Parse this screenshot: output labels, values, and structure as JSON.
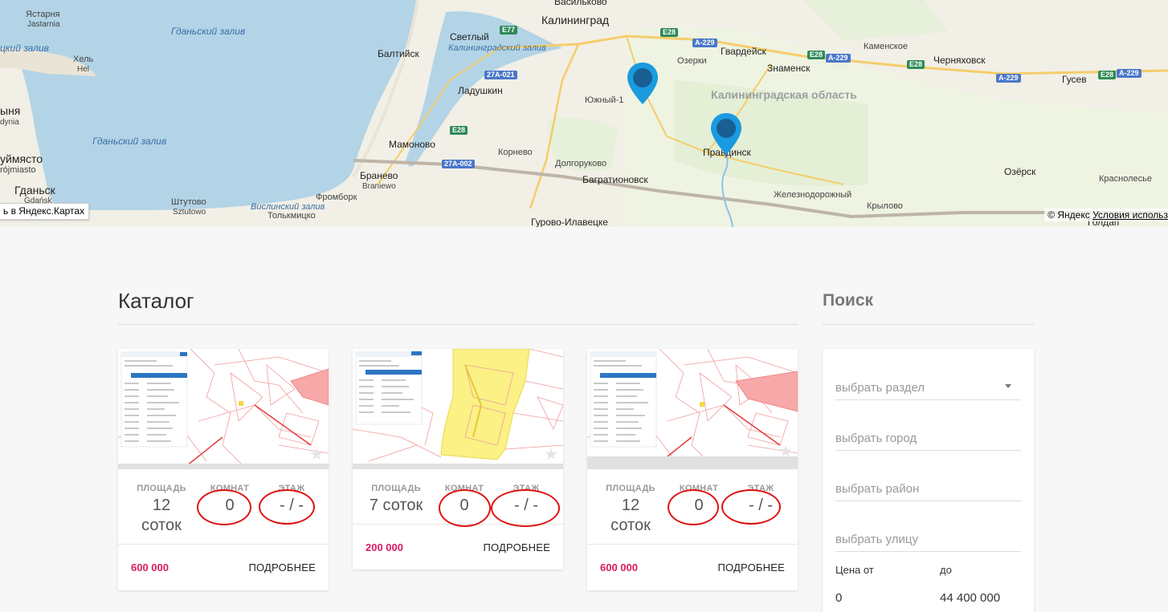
{
  "map": {
    "open_link": "ь в Яндекс.Картах",
    "copyright": "© Яндекс",
    "terms_link": "Условия использ",
    "region_label": "Калининградская область",
    "places": {
      "kaliningrad": "Калининград",
      "vasilkovo": "Васильково",
      "svetly": "Светлый",
      "baltiysk": "Балтийск",
      "ladushkin": "Ладушкин",
      "mamonovo": "Мамоново",
      "kornevo": "Корнево",
      "dolgorukovo": "Долгоруково",
      "bagrationovsk": "Багратионовск",
      "yuzhny": "Южный-1",
      "ozerki": "Озерки",
      "gvardeysk": "Гвардейск",
      "znamensk": "Знаменск",
      "kamenskoe": "Каменское",
      "chernyakhovsk": "Черняховск",
      "gusev": "Гусев",
      "pravdinsk": "Правдинск",
      "ozyorsk": "Озёрск",
      "zheleznodorozhny": "Железнодорожный",
      "krylovo": "Крылово",
      "krasnolesye": "Краснолесье",
      "goldap": "Голдап",
      "gurovo": "Гурово-Илавецке",
      "braniewo_ru": "Бранево",
      "braniewo_pl": "Braniewo",
      "frombork": "Фромборк",
      "shtutovo_ru": "Штутово",
      "shtutovo_pl": "Sztutowo",
      "tolkmicko": "Толькмицко",
      "yastarnya_ru": "Ястарня",
      "yastarnya_pl": "Jastarnia",
      "hel_ru": "Хель",
      "hel_pl": "Hel",
      "gdynia_ru": "ыня",
      "gdynia_pl": "dynia",
      "sopot_ru": "уймясто",
      "sopot_pl": "rójmiasto",
      "gdansk_ru": "Гданьск",
      "gdansk_pl": "Gdańsk"
    },
    "water": {
      "gulf1": "Гданьский залив",
      "gulf2": "Гданьский залив",
      "gulf3": "цкий залив",
      "kal_gulf": "Калининградский залив",
      "vist_gulf": "Вислинский залив"
    },
    "roads": {
      "e77": "E77",
      "e28a": "E28",
      "e28b": "E28",
      "e28c": "E28",
      "e28d": "E28",
      "e28e": "E28",
      "a229a": "A-229",
      "a229b": "A-229",
      "a229c": "A-229",
      "a229d": "A-229",
      "r021": "27A-021",
      "r002": "27A-002"
    }
  },
  "catalog": {
    "title": "Каталог",
    "cards": [
      {
        "specs": [
          {
            "title": "ПЛОЩАДЬ",
            "value": "12 соток"
          },
          {
            "title": "КОМНАТ",
            "value": "0"
          },
          {
            "title": "ЭТАЖ",
            "value": "- / -"
          }
        ],
        "price": "600 000",
        "more": "ПОДРОБНЕЕ"
      },
      {
        "specs": [
          {
            "title": "ПЛОЩАДЬ",
            "value": "7 соток"
          },
          {
            "title": "КОМНАТ",
            "value": "0"
          },
          {
            "title": "ЭТАЖ",
            "value": "- / -"
          }
        ],
        "price": "200 000",
        "more": "ПОДРОБНЕЕ"
      },
      {
        "specs": [
          {
            "title": "ПЛОЩАДЬ",
            "value": "12 соток"
          },
          {
            "title": "КОМНАТ",
            "value": "0"
          },
          {
            "title": "ЭТАЖ",
            "value": "- / -"
          }
        ],
        "price": "600 000",
        "more": "ПОДРОБНЕЕ"
      }
    ]
  },
  "search": {
    "title": "Поиск",
    "section_placeholder": "выбрать раздел",
    "city_placeholder": "выбрать город",
    "district_placeholder": "выбрать район",
    "street_placeholder": "выбрать улицу",
    "price_from_label": "Цена от",
    "price_to_label": "до",
    "price_from": "0",
    "price_to": "44 400 000"
  },
  "colors": {
    "accent_price": "#d81b60",
    "pin": "#1a9be0",
    "annotation": "#e01010"
  }
}
